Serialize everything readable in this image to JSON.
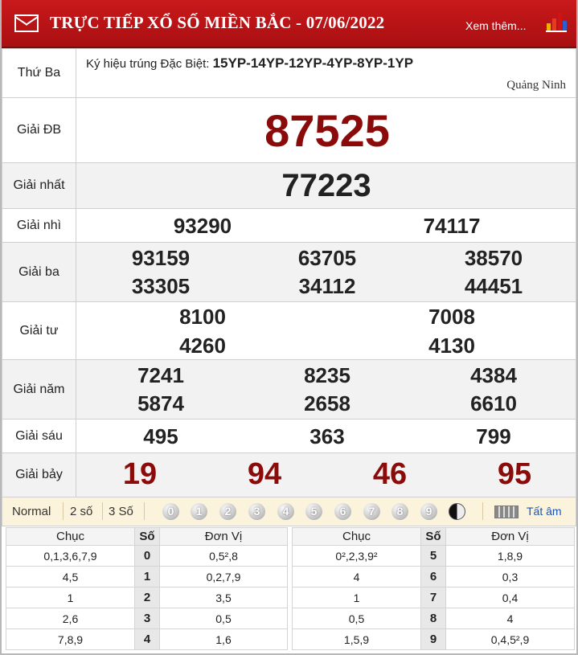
{
  "header": {
    "title": "TRỰC TIẾP XỔ SỐ MIỀN BẮC - 07/06/2022",
    "more_link": "Xem thêm...",
    "mail_icon": "mail-icon",
    "chart_icon": "bar-chart-icon"
  },
  "info": {
    "day": "Thứ Ba",
    "ky_hieu_label": "Ký hiệu trúng Đặc Biệt:",
    "ky_hieu_value": "15YP-14YP-12YP-4YP-8YP-1YP",
    "province": "Quảng Ninh"
  },
  "prizes": {
    "db": {
      "label": "Giải ĐB",
      "numbers": [
        "87525"
      ]
    },
    "nhat": {
      "label": "Giải nhất",
      "numbers": [
        "77223"
      ]
    },
    "nhi": {
      "label": "Giải nhì",
      "numbers": [
        "93290",
        "74117"
      ]
    },
    "ba": {
      "label": "Giải ba",
      "numbers": [
        "93159",
        "63705",
        "38570",
        "33305",
        "34112",
        "44451"
      ]
    },
    "tu": {
      "label": "Giải tư",
      "numbers": [
        "8100",
        "7008",
        "4260",
        "4130"
      ]
    },
    "nam": {
      "label": "Giải năm",
      "numbers": [
        "7241",
        "8235",
        "4384",
        "5874",
        "2658",
        "6610"
      ]
    },
    "sau": {
      "label": "Giải sáu",
      "numbers": [
        "495",
        "363",
        "799"
      ]
    },
    "bay": {
      "label": "Giải bảy",
      "numbers": [
        "19",
        "94",
        "46",
        "95"
      ]
    }
  },
  "toolbar": {
    "modes": [
      "Normal",
      "2 số",
      "3 Số"
    ],
    "digits": [
      "0",
      "1",
      "2",
      "3",
      "4",
      "5",
      "6",
      "7",
      "8",
      "9"
    ],
    "all_label": "Tất âm",
    "colors": {
      "bg": "#fbf3dc",
      "accent": "#c9191b",
      "dark_red": "#8b0b0b",
      "link": "#1a56b0"
    }
  },
  "loto": {
    "headers": {
      "chuc": "Chục",
      "so": "Số",
      "donvi": "Đơn Vị"
    },
    "left": [
      {
        "chuc": "0,1,3,6,7,9",
        "so": "0",
        "donvi": "0,5²,8"
      },
      {
        "chuc": "4,5",
        "so": "1",
        "donvi": "0,2,7,9"
      },
      {
        "chuc": "1",
        "so": "2",
        "donvi": "3,5"
      },
      {
        "chuc": "2,6",
        "so": "3",
        "donvi": "0,5"
      },
      {
        "chuc": "7,8,9",
        "so": "4",
        "donvi": "1,6"
      }
    ],
    "right": [
      {
        "chuc": "0²,2,3,9²",
        "so": "5",
        "donvi": "1,8,9"
      },
      {
        "chuc": "4",
        "so": "6",
        "donvi": "0,3"
      },
      {
        "chuc": "1",
        "so": "7",
        "donvi": "0,4"
      },
      {
        "chuc": "0,5",
        "so": "8",
        "donvi": "4"
      },
      {
        "chuc": "1,5,9",
        "so": "9",
        "donvi": "0,4,5²,9"
      }
    ]
  }
}
